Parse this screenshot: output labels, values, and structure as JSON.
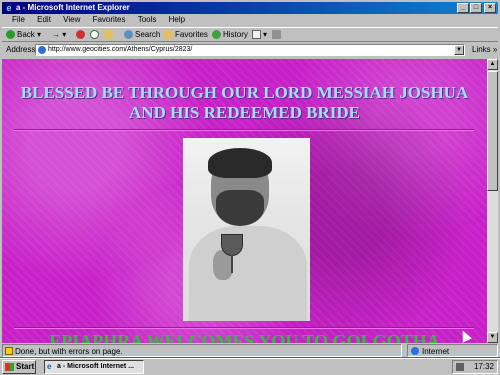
{
  "window": {
    "title": "a - Microsoft Internet Explorer",
    "minimize": "_",
    "maximize": "□",
    "close": "×"
  },
  "menu": [
    "File",
    "Edit",
    "View",
    "Favorites",
    "Tools",
    "Help"
  ],
  "toolbar": {
    "back": "Back",
    "forward_arrow": "→",
    "search": "Search",
    "favorites": "Favorites",
    "history": "History"
  },
  "address": {
    "label": "Address",
    "url": "http://www.geocities.com/Athens/Cyprus/2823/",
    "links": "Links »"
  },
  "page": {
    "headline": "BLESSED BE THROUGH OUR LORD MESSIAH JOSHUA AND HIS REDEEMED BRIDE",
    "bottom_text": "EPIAPHRA WELCOMES YOU TO GOLGOTHA",
    "colors": {
      "background": "#c820c8",
      "headline": "#a0e0ff",
      "bottom_text": "#2fbf3a"
    }
  },
  "status": {
    "text": "Done, but with errors on page.",
    "zone": "Internet"
  },
  "taskbar": {
    "start": "Start",
    "task": "a - Microsoft Internet ...",
    "clock": "17:32"
  },
  "icons": [
    "ie-icon",
    "back-icon",
    "stop-icon",
    "refresh-icon",
    "home-icon",
    "search-icon",
    "favorites-icon",
    "history-icon",
    "mail-icon",
    "print-icon",
    "warning-icon",
    "globe-icon"
  ]
}
